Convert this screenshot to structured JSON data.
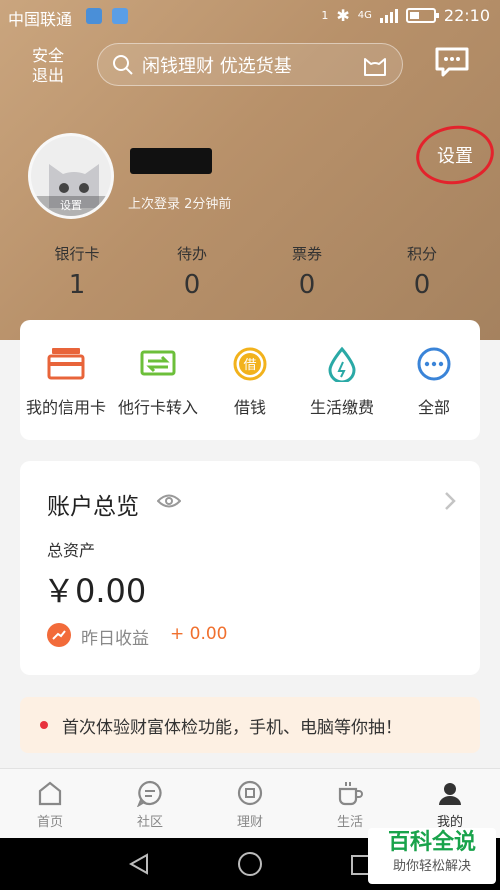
{
  "status_bar": {
    "carrier": "中国联通",
    "network": "4G",
    "time": "22:10",
    "sim_indicator": "1"
  },
  "header": {
    "logout_label": "安全退出",
    "search_placeholder": "闲钱理财 优选货基"
  },
  "profile": {
    "avatar_tag": "设置",
    "last_login": "上次登录 2分钟前",
    "settings_label": "设置"
  },
  "stats": [
    {
      "label": "银行卡",
      "value": "1"
    },
    {
      "label": "待办",
      "value": "0"
    },
    {
      "label": "票券",
      "value": "0"
    },
    {
      "label": "积分",
      "value": "0"
    }
  ],
  "quick_actions": [
    {
      "label": "我的信用卡",
      "icon": "credit-card-icon",
      "color": "#e8643a"
    },
    {
      "label": "他行卡转入",
      "icon": "transfer-card-icon",
      "color": "#6cbf3a"
    },
    {
      "label": "借钱",
      "icon": "borrow-icon",
      "color": "#f2b21c",
      "glyph": "借"
    },
    {
      "label": "生活缴费",
      "icon": "water-drop-icon",
      "color": "#2aa9a6"
    },
    {
      "label": "全部",
      "icon": "more-icon",
      "color": "#3a84d8"
    }
  ],
  "account": {
    "title": "账户总览",
    "asset_label": "总资产",
    "asset_amount": "￥0.00",
    "yesterday_label": "昨日收益",
    "yesterday_value": "+ 0.00"
  },
  "notice": {
    "text": "首次体验财富体检功能，手机、电脑等你抽！"
  },
  "tabs": [
    {
      "label": "首页",
      "icon": "home-icon"
    },
    {
      "label": "社区",
      "icon": "community-icon"
    },
    {
      "label": "理财",
      "icon": "finance-icon"
    },
    {
      "label": "生活",
      "icon": "life-cup-icon"
    },
    {
      "label": "我的",
      "icon": "profile-icon",
      "active": true
    }
  ],
  "watermark": {
    "title": "百科全说",
    "subtitle": "助你轻松解决"
  },
  "colors": {
    "header_gold": "#b8916a",
    "accent_orange": "#f0702e",
    "highlight_red": "#e3232c"
  }
}
